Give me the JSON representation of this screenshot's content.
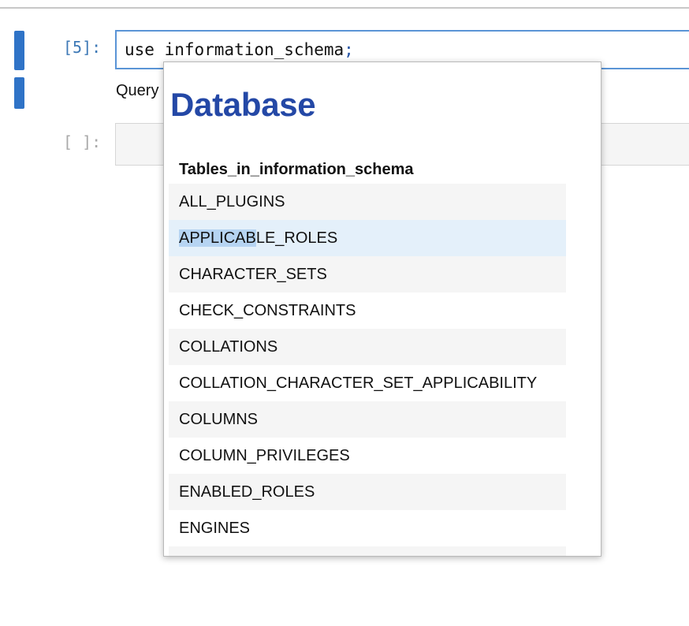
{
  "cells": [
    {
      "prompt": "[5]:",
      "code": "use information_schema",
      "code_terminator": ";"
    },
    {
      "prompt": "[ ]:"
    }
  ],
  "output_text_visible": "Query",
  "popup": {
    "title": "Database",
    "table": {
      "header": "Tables_in_information_schema",
      "rows": [
        "ALL_PLUGINS",
        "APPLICABLE_ROLES",
        "CHARACTER_SETS",
        "CHECK_CONSTRAINTS",
        "COLLATIONS",
        "COLLATION_CHARACTER_SET_APPLICABILITY",
        "COLUMNS",
        "COLUMN_PRIVILEGES",
        "ENABLED_ROLES",
        "ENGINES"
      ],
      "hovered_row": "APPLICABLE_ROLES",
      "selected_text": "APPLICAB",
      "selected_text_rest": "LE_ROLES"
    }
  },
  "colors": {
    "accent": "#2f73c7",
    "title": "#2448a6",
    "row_stripe": "#f5f5f5",
    "row_hover": "#e4f0fa"
  }
}
